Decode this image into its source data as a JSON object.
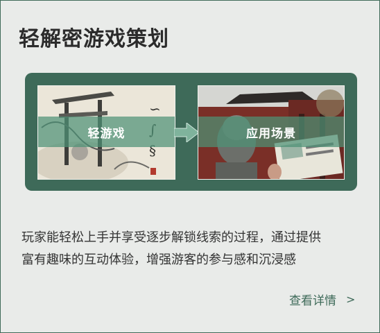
{
  "card": {
    "title": "轻解密游戏策划",
    "hero": {
      "left_label": "轻游戏",
      "right_label": "应用场景",
      "accent_color": "#3e6a59",
      "band_color": "#4e9276"
    },
    "description_lines": [
      "玩家能轻松上手并享受逐步解锁线索的过程，通过提供",
      "富有趣味的互动体验，增强游客的参与感和沉浸感"
    ],
    "more_link": {
      "label": "查看详情",
      "icon": "chevron-right-icon",
      "chevron": ">"
    }
  }
}
